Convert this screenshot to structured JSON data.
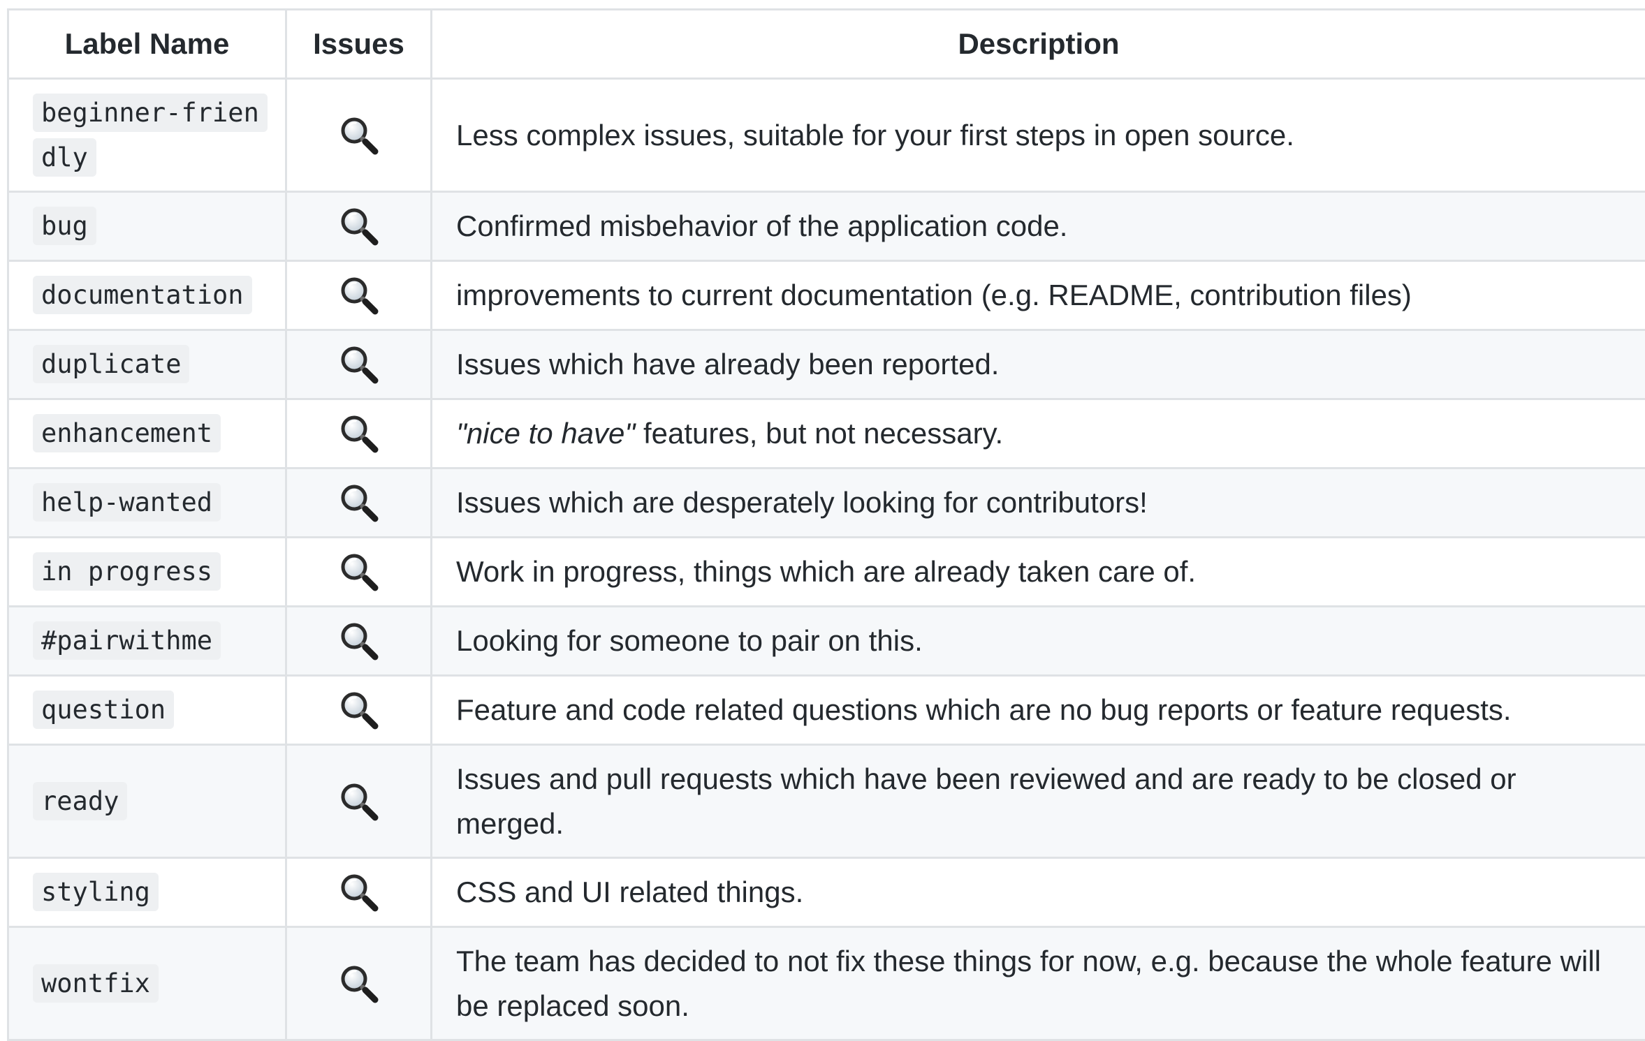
{
  "table": {
    "headers": {
      "name": "Label Name",
      "issues": "Issues",
      "description": "Description"
    },
    "icon": "magnifying-glass-icon",
    "rows": [
      {
        "label": "beginner-friendly",
        "description_em": "",
        "description": "Less complex issues, suitable for your first steps in open source."
      },
      {
        "label": "bug",
        "description_em": "",
        "description": "Confirmed misbehavior of the application code."
      },
      {
        "label": "documentation",
        "description_em": "",
        "description": "improvements to current documentation (e.g. README, contribution files)"
      },
      {
        "label": "duplicate",
        "description_em": "",
        "description": "Issues which have already been reported."
      },
      {
        "label": "enhancement",
        "description_em": "\"nice to have\"",
        "description": " features, but not necessary."
      },
      {
        "label": "help-wanted",
        "description_em": "",
        "description": "Issues which are desperately looking for contributors!"
      },
      {
        "label": "in progress",
        "description_em": "",
        "description": "Work in progress, things which are already taken care of."
      },
      {
        "label": "#pairwithme",
        "description_em": "",
        "description": "Looking for someone to pair on this."
      },
      {
        "label": "question",
        "description_em": "",
        "description": "Feature and code related questions which are no bug reports or feature requests."
      },
      {
        "label": "ready",
        "description_em": "",
        "description": "Issues and pull requests which have been reviewed and are ready to be closed or merged."
      },
      {
        "label": "styling",
        "description_em": "",
        "description": "CSS and UI related things."
      },
      {
        "label": "wontfix",
        "description_em": "",
        "description": "The team has decided to not fix these things for now, e.g. because the whole feature will be replaced soon."
      }
    ]
  }
}
